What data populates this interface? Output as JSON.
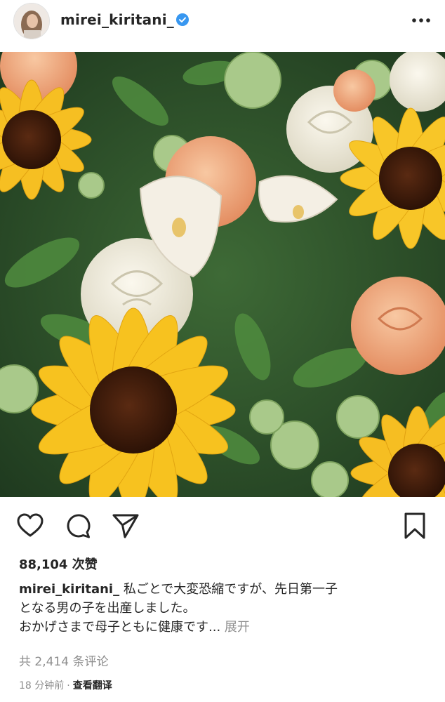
{
  "post": {
    "username": "mirei_kiritani_",
    "likes": "88,104 次赞",
    "caption_user": "mirei_kiritani_",
    "caption_line1": "私ごとで大変恐縮ですが、先日第一子",
    "caption_line2": "となる男の子を出産しました。",
    "caption_line3": "おかげさまで母子ともに健康です...",
    "caption_more": "展开",
    "comments": "共 2,414 条评论",
    "time": "18 分钟前",
    "dot": "·",
    "translate": "查看翻译"
  },
  "icons": {
    "verified": "verified-badge-icon",
    "more": "more-options-icon",
    "like": "heart-icon",
    "comment": "comment-icon",
    "share": "paper-plane-icon",
    "save": "bookmark-icon"
  },
  "colors": {
    "text": "#262626",
    "muted": "#8e8e8e",
    "verified_blue": "#3897f0"
  }
}
